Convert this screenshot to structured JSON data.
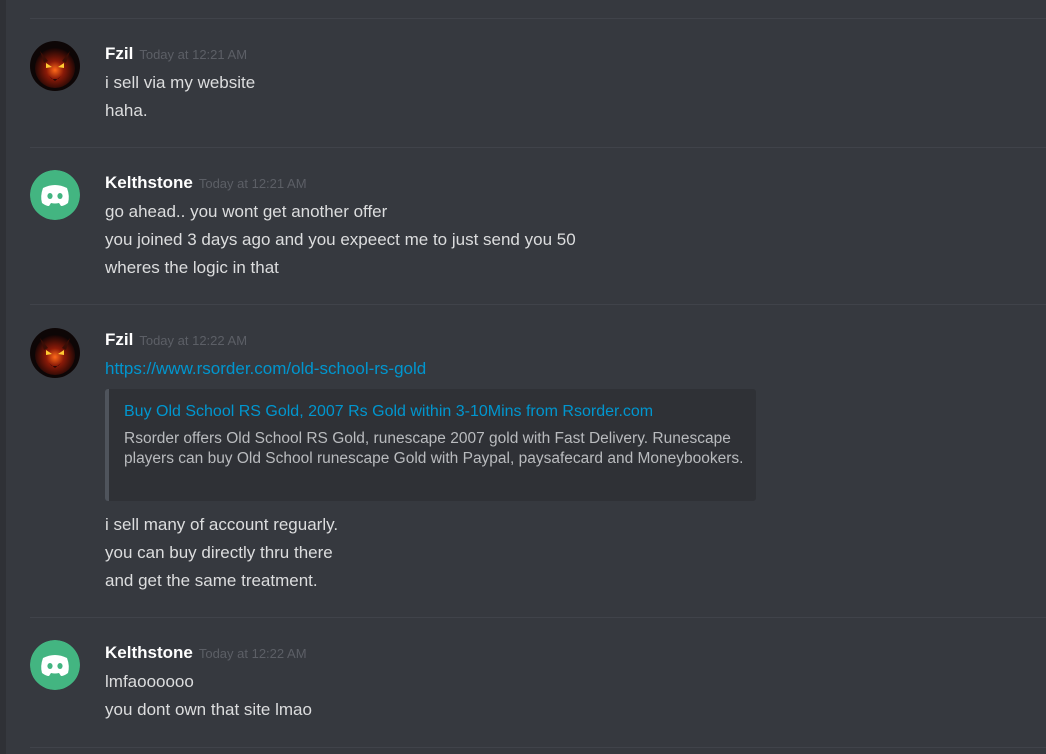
{
  "messages": [
    {
      "author": "Fzil",
      "timestamp": "Today at 12:21 AM",
      "avatar": "demon-avatar",
      "lines": [
        "i sell via my website",
        "haha."
      ]
    },
    {
      "author": "Kelthstone",
      "timestamp": "Today at 12:21 AM",
      "avatar": "discord-default-avatar",
      "lines": [
        "go ahead.. you wont get another offer",
        "you joined 3 days ago and you expeect me to just send you 50",
        "wheres the logic in that"
      ]
    },
    {
      "author": "Fzil",
      "timestamp": "Today at 12:22 AM",
      "avatar": "demon-avatar",
      "link": "https://www.rsorder.com/old-school-rs-gold",
      "embed": {
        "title": "Buy Old School RS Gold, 2007 Rs Gold within 3-10Mins from Rsorder.com",
        "description": "Rsorder offers Old School RS Gold, runescape 2007 gold with Fast Delivery. Runescape players can buy Old School runescape Gold with Paypal, paysafecard and Moneybookers."
      },
      "lines": [
        "i sell many of account reguarly.",
        "you can buy directly thru there",
        "and get the same treatment."
      ]
    },
    {
      "author": "Kelthstone",
      "timestamp": "Today at 12:22 AM",
      "avatar": "discord-default-avatar",
      "lines": [
        "lmfaoooooo",
        "you dont own that site lmao"
      ]
    }
  ],
  "colors": {
    "background": "#36393f",
    "username": "#ffffff",
    "timestamp": "#5c5f66",
    "text": "#dcddde",
    "link": "#0096cf",
    "discord_green": "#43b581"
  }
}
